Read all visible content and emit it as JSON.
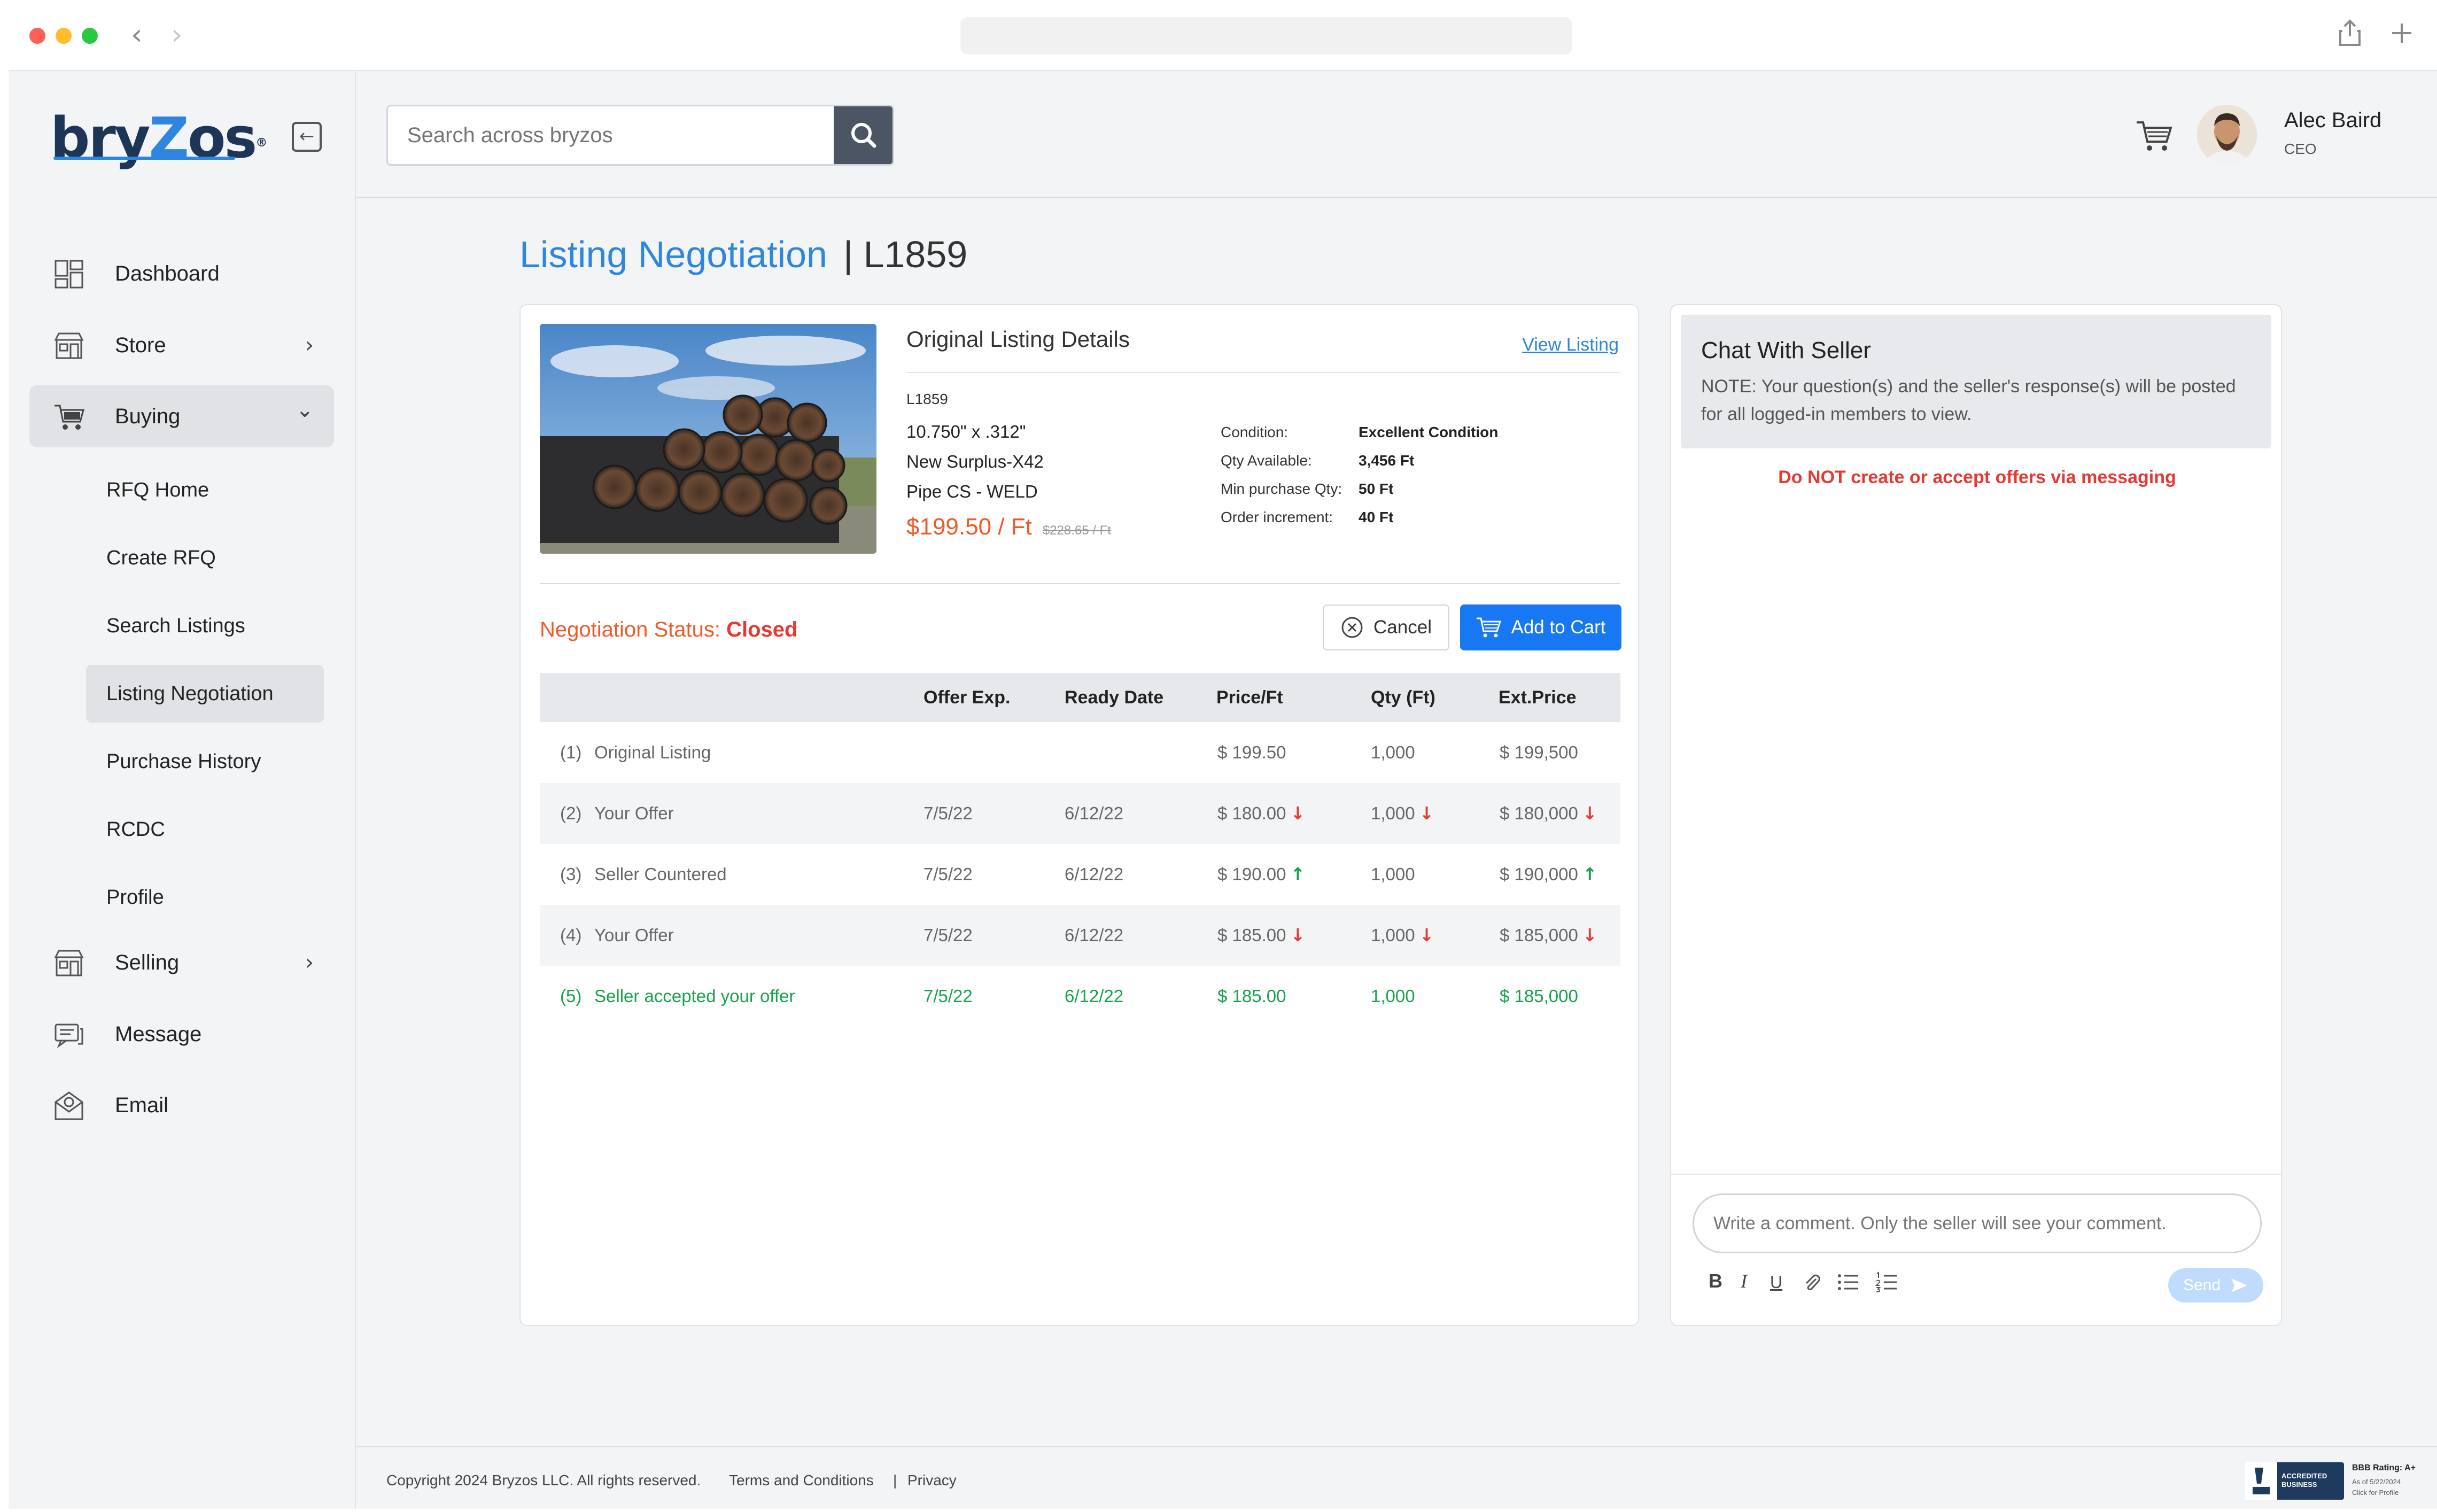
{
  "browser": {
    "back_icon": "chevron-left-icon",
    "forward_icon": "chevron-right-icon",
    "share_icon": "share-icon",
    "new_tab_icon": "plus-icon",
    "traffic_colors": [
      "#ff5f57",
      "#febc2e",
      "#28c840"
    ]
  },
  "brand": {
    "logo_text_1": "bry",
    "logo_text_2": "Z",
    "logo_text_3": "os",
    "registered": "®",
    "primary_color": "#2e86de",
    "accent_color": "#f05a28"
  },
  "sidebar": {
    "items": [
      {
        "label": "Dashboard",
        "icon": "dashboard-icon"
      },
      {
        "label": "Store",
        "icon": "store-icon",
        "chevron": "›"
      },
      {
        "label": "Buying",
        "icon": "cart-icon",
        "chevron": "⌄"
      },
      {
        "label": "Selling",
        "icon": "store-icon",
        "chevron": "›"
      },
      {
        "label": "Message",
        "icon": "message-icon"
      },
      {
        "label": "Email",
        "icon": "email-icon"
      }
    ],
    "subitems": [
      {
        "label": "RFQ Home"
      },
      {
        "label": "Create RFQ"
      },
      {
        "label": "Search Listings"
      },
      {
        "label": "Listing Negotiation"
      },
      {
        "label": "Purchase History"
      },
      {
        "label": "RCDC"
      },
      {
        "label": "Profile"
      }
    ]
  },
  "header": {
    "search_placeholder": "Search across bryzos",
    "user_name": "Alec Baird",
    "user_role": "CEO",
    "caret": "▾"
  },
  "page": {
    "title": "Listing Negotiation",
    "listing_ref": "| L1859"
  },
  "listing": {
    "section_title": "Original Listing Details",
    "view_link": "View Listing",
    "id": "L1859",
    "spec_1": "10.750\" x .312\"",
    "spec_2": "New Surplus-X42",
    "spec_3": "Pipe CS - WELD",
    "price": "$199.50 / Ft",
    "old_price": "$228.65 / Ft",
    "details": [
      {
        "k": "Condition:",
        "v": "Excellent Condition"
      },
      {
        "k": "Qty Available:",
        "v": "3,456 Ft"
      },
      {
        "k": "Min purchase Qty:",
        "v": "50 Ft"
      },
      {
        "k": "Order increment:",
        "v": "40 Ft"
      }
    ]
  },
  "negotiation": {
    "status_label": "Negotiation Status: ",
    "status_value": "Closed",
    "cancel_label": "Cancel",
    "add_to_cart_label": "Add to Cart",
    "columns": [
      "Offer Exp.",
      "Ready Date",
      "Price/Ft",
      "Qty (Ft)",
      "Ext.Price"
    ],
    "rows": [
      {
        "num": "(1)",
        "label": "Original Listing",
        "exp": "",
        "ready": "",
        "price": "$ 199.50",
        "qty": "1,000",
        "ext": "$ 199,500",
        "price_arrow": "",
        "qty_arrow": "",
        "ext_arrow": ""
      },
      {
        "num": "(2)",
        "label": "Your Offer",
        "exp": "7/5/22",
        "ready": "6/12/22",
        "price": "$ 180.00",
        "qty": "1,000",
        "ext": "$ 180,000",
        "price_arrow": "↓",
        "qty_arrow": "↓",
        "ext_arrow": "↓"
      },
      {
        "num": "(3)",
        "label": "Seller Countered",
        "exp": "7/5/22",
        "ready": "6/12/22",
        "price": "$ 190.00",
        "qty": "1,000",
        "ext": "$ 190,000",
        "price_arrow": "↑",
        "qty_arrow": "",
        "ext_arrow": "↑"
      },
      {
        "num": "(4)",
        "label": "Your Offer",
        "exp": "7/5/22",
        "ready": "6/12/22",
        "price": "$ 185.00",
        "qty": "1,000",
        "ext": "$ 185,000",
        "price_arrow": "↓",
        "qty_arrow": "↓",
        "ext_arrow": "↓"
      },
      {
        "num": "(5)",
        "label": "Seller accepted your offer",
        "exp": "7/5/22",
        "ready": "6/12/22",
        "price": "$ 185.00",
        "qty": "1,000",
        "ext": "$ 185,000",
        "price_arrow": "",
        "qty_arrow": "",
        "ext_arrow": ""
      }
    ]
  },
  "chat": {
    "title": "Chat With Seller",
    "note": "NOTE: Your question(s) and the seller's response(s) will be posted for all logged-in members to view.",
    "warning": "Do NOT create or accept offers via messaging",
    "input_placeholder": "Write a comment. Only the seller will see your comment.",
    "format_bold": "B",
    "format_italic": "I",
    "format_underline": "U",
    "send_label": "Send"
  },
  "footer": {
    "copyright": "Copyright 2024 Bryzos  LLC. All rights reserved.",
    "terms": "Terms and Conditions",
    "separator": "|",
    "privacy": "Privacy",
    "bbb_label": "ACCREDITED BUSINESS",
    "bbb_rating": "BBB Rating: A+",
    "bbb_date": "As of 5/22/2024",
    "bbb_click": "Click for Profile"
  }
}
